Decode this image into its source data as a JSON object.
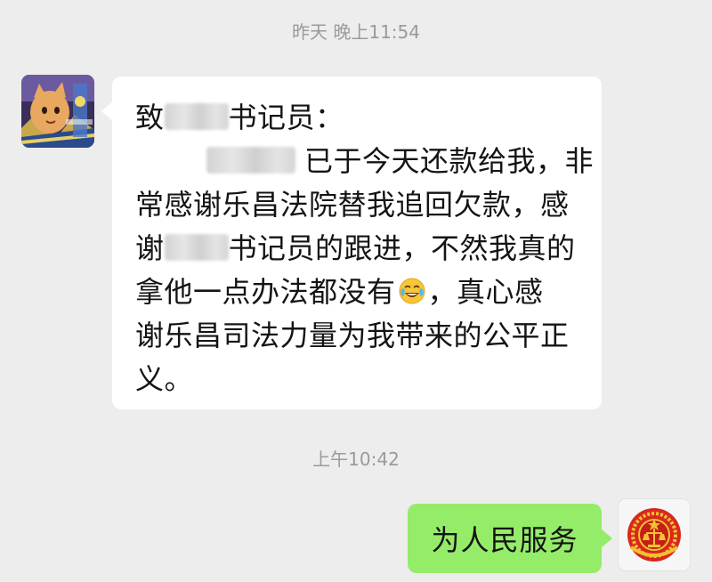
{
  "timestamps": {
    "first": "昨天 晚上11:54",
    "second": "上午10:42"
  },
  "incoming_message": {
    "line1_prefix": "致",
    "line1_suffix": "书记员：",
    "line2_suffix": "已于今天还款给我，非",
    "line3": "常感谢乐昌法院替我追回欠款，感",
    "line4_prefix": "谢",
    "line4_suffix": "书记员的跟进，不然我真的",
    "line5_prefix": "拿他一点办法都没有",
    "line5_suffix": "，真心感",
    "line6": "谢乐昌司法力量为我带来的公平正",
    "line7": "义。",
    "emoji": "crying-laughing-emoji"
  },
  "outgoing_message": {
    "text": "为人民服务"
  },
  "avatars": {
    "left": "anime-cat-avatar",
    "right": "court-emblem-avatar"
  },
  "colors": {
    "background": "#ededed",
    "incoming_bubble": "#ffffff",
    "outgoing_bubble": "#95ec69",
    "timestamp_text": "#9a9a9a",
    "message_text": "#141414"
  }
}
